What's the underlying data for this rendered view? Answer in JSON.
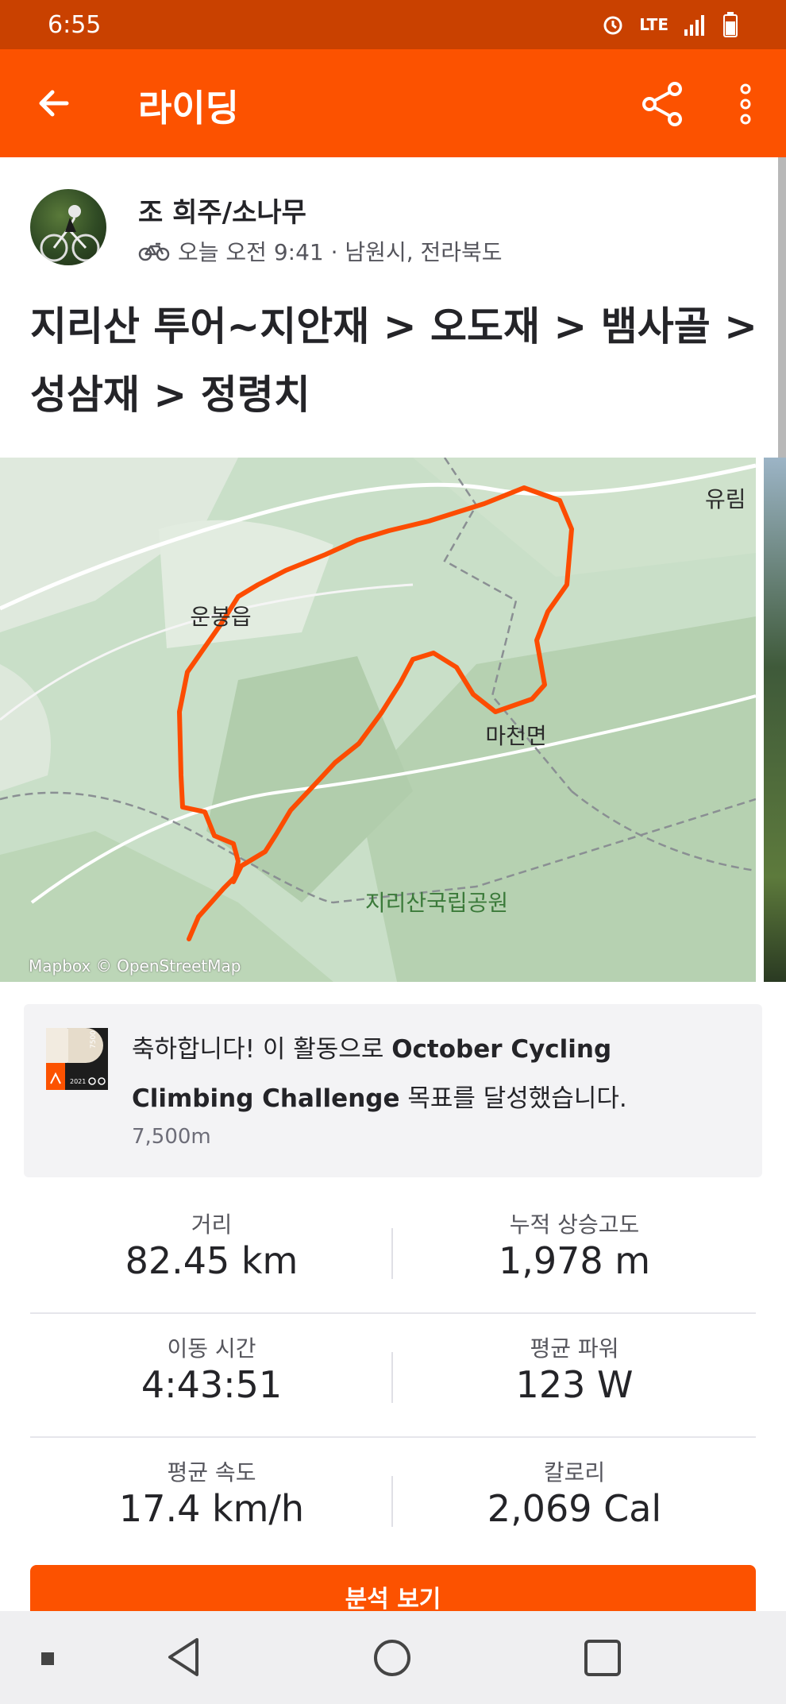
{
  "status_bar": {
    "time": "6:55",
    "network": "LTE"
  },
  "app_bar": {
    "title": "라이딩"
  },
  "activity": {
    "author": "조 희주/소나무",
    "meta": "오늘 오전 9:41 · 남원시, 전라북도",
    "title": "지리산 투어~지안재 > 오도재 > 뱀사골 > 성삼재 > 정령치"
  },
  "map": {
    "labels": {
      "town1": "운봉읍",
      "town2": "마천면",
      "park": "지리산국립공원",
      "town3": "유림"
    },
    "attribution": "Mapbox © OpenStreetMap",
    "route_color": "#fc4c02"
  },
  "challenge": {
    "message_prefix": "축하합니다! 이 활동으로 ",
    "challenge_name": "October Cycling Climbing Challenge",
    "message_suffix": " 목표를 달성했습니다.",
    "goal": "7,500m",
    "badge_text_top": "7500",
    "badge_text_year": "2021"
  },
  "stats": [
    [
      {
        "label": "거리",
        "value": "82.45 km"
      },
      {
        "label": "누적 상승고도",
        "value": "1,978 m"
      }
    ],
    [
      {
        "label": "이동 시간",
        "value": "4:43:51"
      },
      {
        "label": "평균 파워",
        "value": "123 W"
      }
    ],
    [
      {
        "label": "평균 속도",
        "value": "17.4 km/h"
      },
      {
        "label": "칼로리",
        "value": "2,069 Cal"
      }
    ]
  ],
  "analysis_button": "분석 보기",
  "colors": {
    "brand": "#fc5200",
    "status_bar": "#c94100"
  }
}
